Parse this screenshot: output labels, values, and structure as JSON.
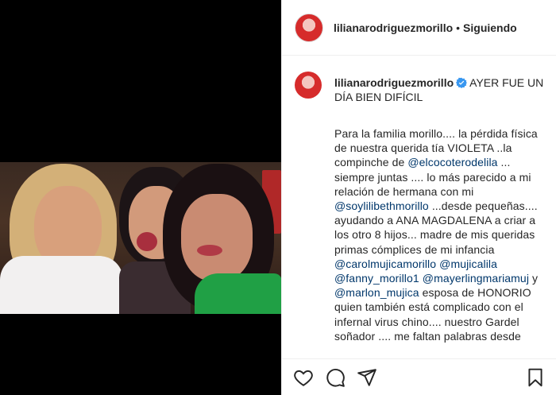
{
  "header": {
    "username": "lilianarodriguezmorillo",
    "separator": "•",
    "follow_status": "Siguiendo"
  },
  "caption": {
    "username": "lilianarodriguezmorillo",
    "title": "AYER FUE UN DÍA BIEN DIFÍCIL",
    "segments": [
      {
        "t": "Para la familia morillo.... la pérdida física de nuestra querida tía VIOLETA ..la compinche de "
      },
      {
        "m": "@elcocoterodelila"
      },
      {
        "t": " ... siempre juntas .... lo más parecido a mi relación de hermana con mi "
      },
      {
        "m": "@soylilibethmorillo"
      },
      {
        "t": " ...desde pequeñas.... ayudando a ANA MAGDALENA a criar a los otro 8 hijos... madre de mis queridas primas cómplices de mi infancia "
      },
      {
        "m": "@carolmujicamorillo"
      },
      {
        "t": " "
      },
      {
        "m": "@mujicalila"
      },
      {
        "t": " "
      },
      {
        "m": "@fanny_morillo1"
      },
      {
        "t": " "
      },
      {
        "m": "@mayerlingmariamuj"
      },
      {
        "t": " y "
      },
      {
        "m": "@marlon_mujica"
      },
      {
        "t": " esposa de HONORIO quien también está complicado con el infernal virus chino.... nuestro Gardel soñador .... me faltan palabras desde"
      }
    ]
  },
  "actions": {
    "like": "heart-icon",
    "comment": "comment-icon",
    "share": "share-icon",
    "save": "bookmark-icon"
  },
  "colors": {
    "mention": "#00376b",
    "verified": "#3897f0",
    "text": "#262626"
  }
}
